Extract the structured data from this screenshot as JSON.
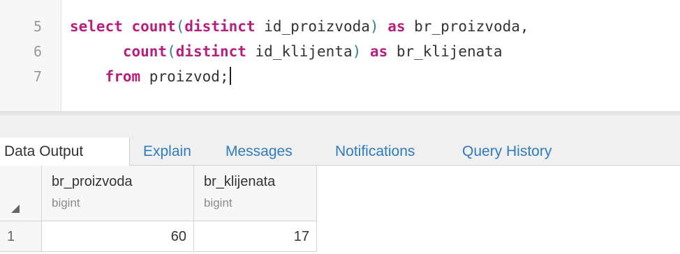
{
  "editor": {
    "line_numbers": [
      "5",
      "6",
      "7"
    ],
    "lines": [
      {
        "kw1": "select",
        "fn1": "count",
        "p1": "(",
        "kw2": "distinct",
        "rest1": " id_proizvoda",
        "p2": ")",
        "kw3": "as",
        "rest2": " br_proizvoda,"
      },
      {
        "fn1": "count",
        "p1": "(",
        "kw2": "distinct",
        "rest1": " id_klijenta",
        "p2": ")",
        "kw3": "as",
        "rest2": " br_klijenata"
      },
      {
        "kw1": "from",
        "rest1": " proizvod;"
      }
    ]
  },
  "tabs": [
    {
      "label": "Data Output",
      "active": true
    },
    {
      "label": "Explain",
      "active": false
    },
    {
      "label": "Messages",
      "active": false
    },
    {
      "label": "Notifications",
      "active": false
    },
    {
      "label": "Query History",
      "active": false
    }
  ],
  "grid": {
    "columns": [
      {
        "name": "br_proizvoda",
        "type": "bigint"
      },
      {
        "name": "br_klijenata",
        "type": "bigint"
      }
    ],
    "rows": [
      {
        "num": "1",
        "values": [
          "60",
          "17"
        ]
      }
    ]
  }
}
